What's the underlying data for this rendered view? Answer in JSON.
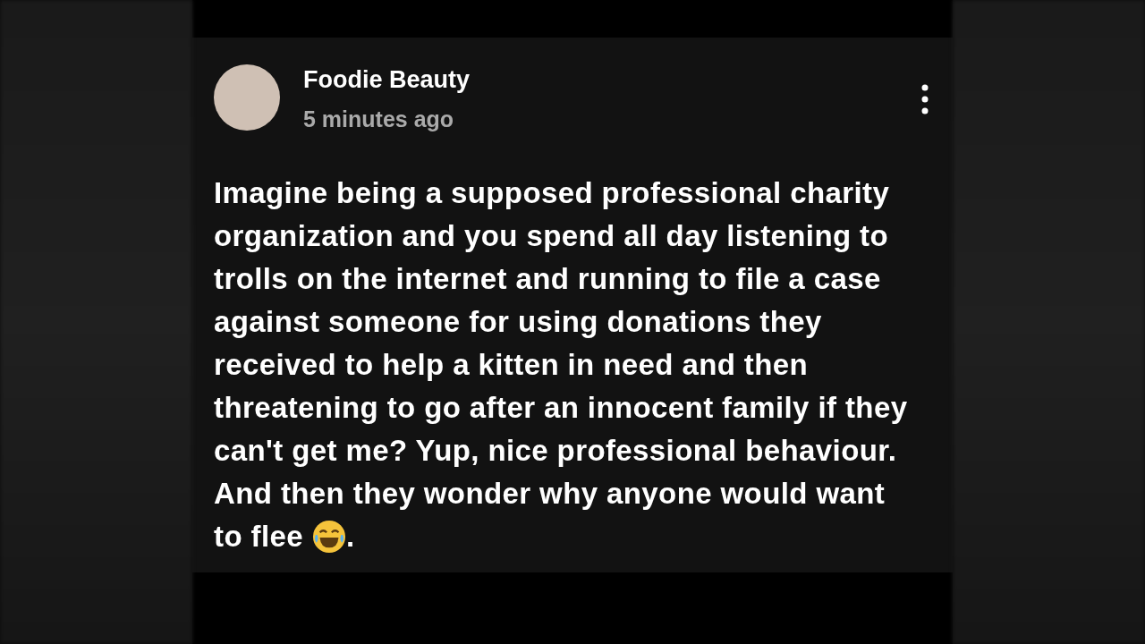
{
  "post": {
    "author": "Foodie Beauty",
    "time": "5 minutes ago",
    "body": "Imagine being a supposed professional charity organization and you spend all day listening to trolls on the internet and running to file a case against someone for using donations they received to help a kitten in need and then threatening to go after an innocent family if they can't get me? Yup, nice professional behaviour. And then they wonder why anyone would want",
    "body_tail": "to flee",
    "body_end": "."
  }
}
